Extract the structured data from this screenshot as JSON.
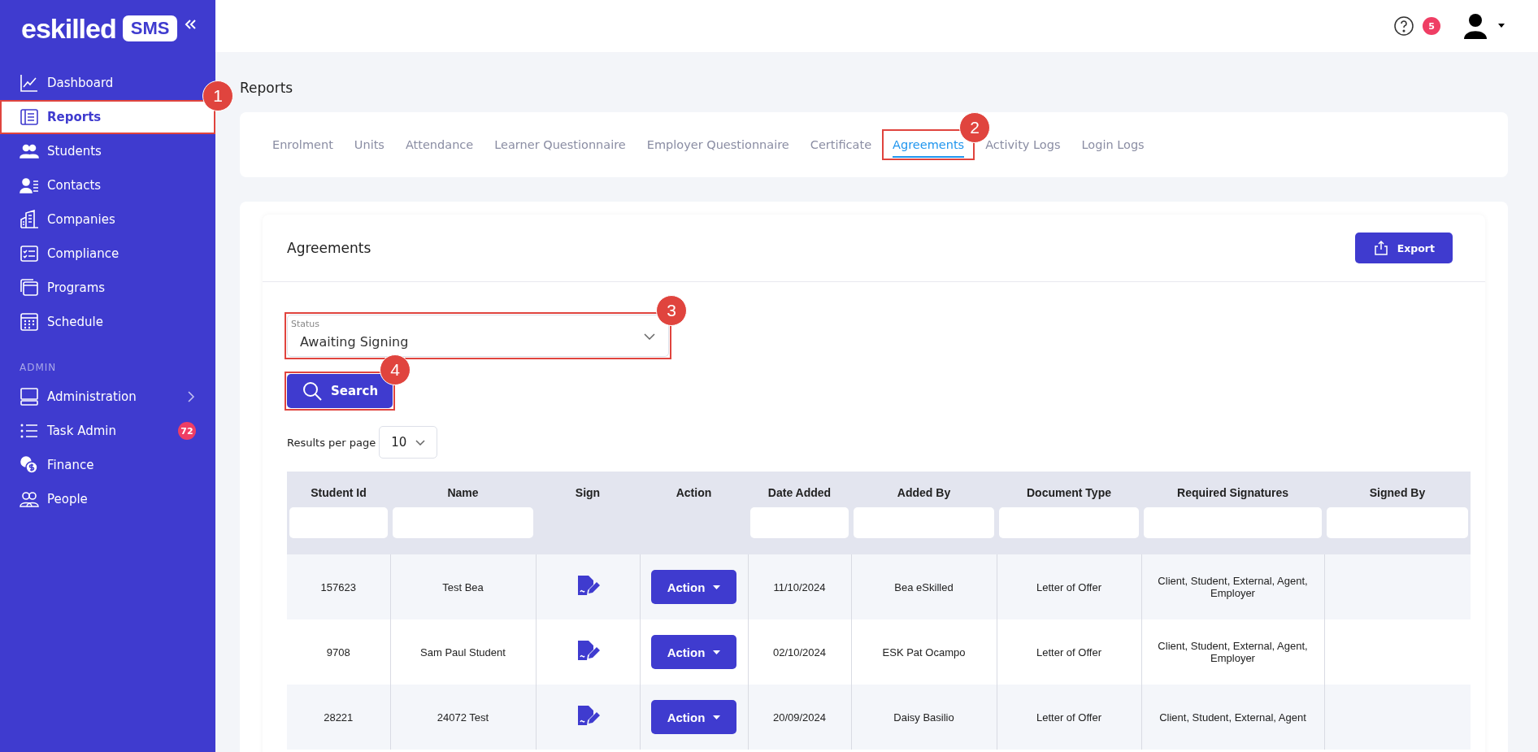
{
  "sidebar": {
    "logo_text": "eskilled",
    "logo_badge": "SMS",
    "items": [
      {
        "label": "Dashboard",
        "selected": false
      },
      {
        "label": "Reports",
        "selected": true,
        "callout": "1"
      },
      {
        "label": "Students",
        "selected": false
      },
      {
        "label": "Contacts",
        "selected": false
      },
      {
        "label": "Companies",
        "selected": false
      },
      {
        "label": "Compliance",
        "selected": false
      },
      {
        "label": "Programs",
        "selected": false
      },
      {
        "label": "Schedule",
        "selected": false
      }
    ],
    "section_label": "ADMIN",
    "admin_items": [
      {
        "label": "Administration",
        "selected": false,
        "expandable": true
      },
      {
        "label": "Task Admin",
        "selected": false,
        "badge": "72"
      },
      {
        "label": "Finance",
        "selected": false
      },
      {
        "label": "People",
        "selected": false
      }
    ]
  },
  "topbar": {
    "notification_count": "5"
  },
  "page_title": "Reports",
  "tabs": [
    {
      "label": "Enrolment",
      "selected": false
    },
    {
      "label": "Units",
      "selected": false
    },
    {
      "label": "Attendance",
      "selected": false
    },
    {
      "label": "Learner Questionnaire",
      "selected": false
    },
    {
      "label": "Employer Questionnaire",
      "selected": false
    },
    {
      "label": "Certificate",
      "selected": false
    },
    {
      "label": "Agreements",
      "selected": true,
      "callout": "2"
    },
    {
      "label": "Activity Logs",
      "selected": false
    },
    {
      "label": "Login Logs",
      "selected": false
    }
  ],
  "card": {
    "title": "Agreements",
    "export_label": "Export"
  },
  "status_field": {
    "label": "Status",
    "value": "Awaiting Signing",
    "callout": "3"
  },
  "search_button": {
    "label": "Search",
    "callout": "4"
  },
  "results_per_page": {
    "label": "Results per page",
    "value": "10"
  },
  "table": {
    "columns": [
      {
        "label": "Student Id",
        "filterable": true
      },
      {
        "label": "Name",
        "filterable": true
      },
      {
        "label": "Sign",
        "filterable": false
      },
      {
        "label": "Action",
        "filterable": false
      },
      {
        "label": "Date Added",
        "filterable": true
      },
      {
        "label": "Added By",
        "filterable": true
      },
      {
        "label": "Document Type",
        "filterable": true
      },
      {
        "label": "Required Signatures",
        "filterable": true
      },
      {
        "label": "Signed By",
        "filterable": true
      }
    ],
    "rows": [
      {
        "student_id": "157623",
        "name": "Test Bea",
        "action": "Action",
        "date_added": "11/10/2024",
        "added_by": "Bea eSkilled",
        "document_type": "Letter of Offer",
        "required_signatures": "Client, Student, External, Agent, Employer"
      },
      {
        "student_id": "9708",
        "name": "Sam Paul Student",
        "action": "Action",
        "date_added": "02/10/2024",
        "added_by": "ESK Pat Ocampo",
        "document_type": "Letter of Offer",
        "required_signatures": "Client, Student, External, Agent, Employer"
      },
      {
        "student_id": "28221",
        "name": "24072 Test",
        "action": "Action",
        "date_added": "20/09/2024",
        "added_by": "Daisy Basilio",
        "document_type": "Letter of Offer",
        "required_signatures": "Client, Student, External, Agent"
      }
    ]
  }
}
